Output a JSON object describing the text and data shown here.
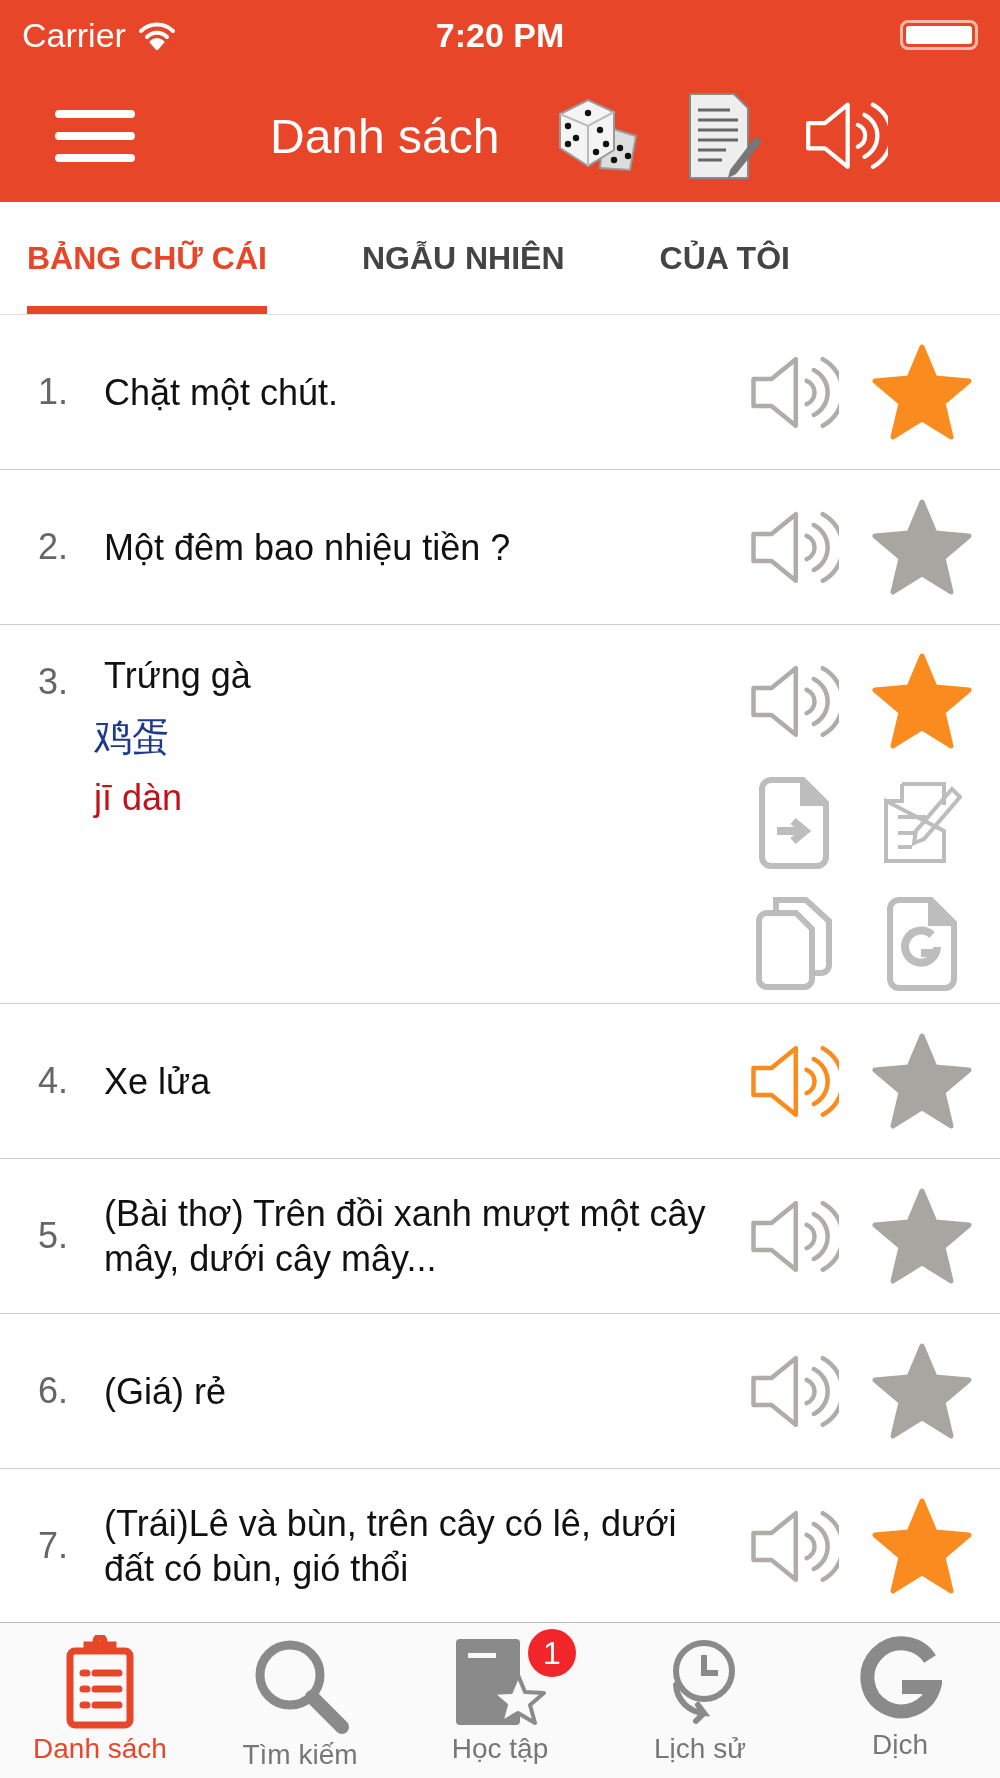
{
  "status_bar": {
    "carrier": "Carrier",
    "time": "7:20 PM"
  },
  "header": {
    "title": "Danh sách"
  },
  "tabs": [
    {
      "label": "BẢNG CHỮ CÁI",
      "selected": true
    },
    {
      "label": "NGẪU NHIÊN",
      "selected": false
    },
    {
      "label": "CỦA TÔI",
      "selected": false
    }
  ],
  "rows": [
    {
      "number": "1.",
      "text": "Chặt một chút.",
      "playing": false,
      "starred": true,
      "expanded": false
    },
    {
      "number": "2.",
      "text": "Một đêm bao nhiệu tiền ?",
      "playing": false,
      "starred": false,
      "expanded": false
    },
    {
      "number": "3.",
      "text": "Trứng gà",
      "chinese": "鸡蛋",
      "pinyin": "jī dàn",
      "playing": false,
      "starred": true,
      "expanded": true
    },
    {
      "number": "4.",
      "text": "Xe lửa",
      "playing": true,
      "starred": false,
      "expanded": false
    },
    {
      "number": "5.",
      "text": "(Bài thơ) Trên đồi xanh mượt một cây mây, dưới cây mây...",
      "playing": false,
      "starred": false,
      "expanded": false
    },
    {
      "number": "6.",
      "text": "(Giá) rẻ",
      "playing": false,
      "starred": false,
      "expanded": false
    },
    {
      "number": "7.",
      "text": "(Trái)Lê và bùn, trên cây có lê, dưới đất có bùn, gió thổi",
      "playing": false,
      "starred": true,
      "expanded": false
    }
  ],
  "tab_bar": [
    {
      "label": "Danh sách",
      "kind": "list",
      "selected": true
    },
    {
      "label": "Tìm kiếm",
      "kind": "search",
      "selected": false
    },
    {
      "label": "Học tập",
      "kind": "study",
      "selected": false,
      "badge": "1"
    },
    {
      "label": "Lịch sử",
      "kind": "history",
      "selected": false
    },
    {
      "label": "Dịch",
      "kind": "translate",
      "selected": false
    }
  ]
}
